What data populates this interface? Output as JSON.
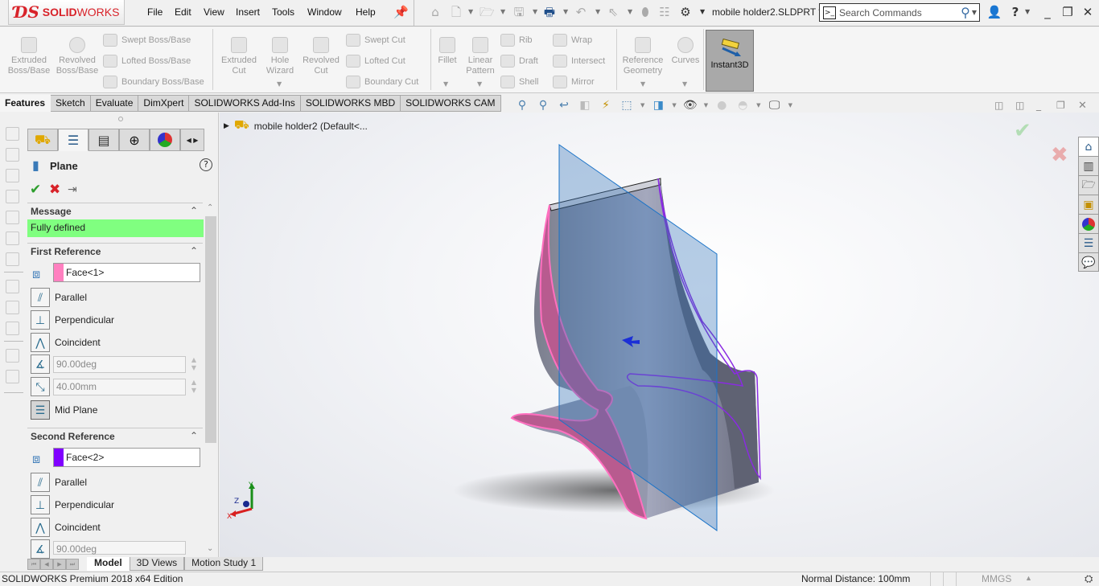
{
  "app": {
    "brand_prefix": "3S",
    "brand_bold": "SOLID",
    "brand_light": "WORKS"
  },
  "menu": [
    "File",
    "Edit",
    "View",
    "Insert",
    "Tools",
    "Window",
    "Help"
  ],
  "document_title": "mobile holder2.SLDPRT *",
  "search": {
    "placeholder": "Search Commands"
  },
  "command_manager": {
    "boss": [
      {
        "label": "Extruded\nBoss/Base"
      },
      {
        "label": "Revolved\nBoss/Base"
      }
    ],
    "boss_small": [
      "Swept Boss/Base",
      "Lofted Boss/Base",
      "Boundary Boss/Base"
    ],
    "cut": [
      {
        "label": "Extruded\nCut"
      },
      {
        "label": "Hole\nWizard"
      },
      {
        "label": "Revolved\nCut"
      }
    ],
    "cut_small": [
      "Swept Cut",
      "Lofted Cut",
      "Boundary Cut"
    ],
    "fillet": "Fillet",
    "linear_pattern": "Linear\nPattern",
    "features_col1": [
      "Rib",
      "Draft",
      "Shell"
    ],
    "features_col2": [
      "Wrap",
      "Intersect",
      "Mirror"
    ],
    "reference_geometry": "Reference\nGeometry",
    "curves": "Curves",
    "instant3d": "Instant3D"
  },
  "tabs": [
    "Features",
    "Sketch",
    "Evaluate",
    "DimXpert",
    "SOLIDWORKS Add-Ins",
    "SOLIDWORKS MBD",
    "SOLIDWORKS CAM"
  ],
  "active_tab": "Features",
  "property_manager": {
    "title": "Plane",
    "message_header": "Message",
    "message": "Fully defined",
    "message_color": "#80ff80",
    "first_reference": {
      "header": "First Reference",
      "selection": "Face<1>",
      "swatch": "#ff80c0",
      "options": [
        "Parallel",
        "Perpendicular",
        "Coincident"
      ],
      "angle": "90.00deg",
      "distance": "40.00mm",
      "mid_plane": "Mid Plane"
    },
    "second_reference": {
      "header": "Second Reference",
      "selection": "Face<2>",
      "swatch": "#8000ff",
      "options": [
        "Parallel",
        "Perpendicular",
        "Coincident"
      ],
      "angle": "90.00deg"
    }
  },
  "feature_tree": {
    "item": "mobile holder2  (Default<..."
  },
  "triad": {
    "x": "X",
    "y": "Y",
    "z": "Z"
  },
  "bottom_tabs": [
    "Model",
    "3D Views",
    "Motion Study 1"
  ],
  "status_bar": {
    "edition": "SOLIDWORKS Premium 2018 x64 Edition",
    "normal_distance": "Normal Distance: 100mm",
    "units": "MMGS"
  },
  "colors": {
    "accent_red": "#d8232a",
    "plane_blue": "#1a73c8",
    "face1": "#ff80c0",
    "face2": "#8000ff"
  }
}
